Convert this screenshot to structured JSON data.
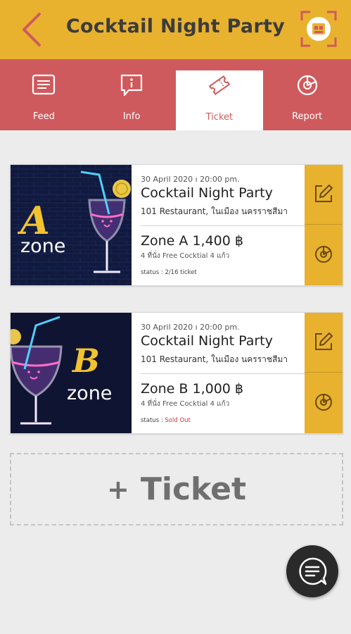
{
  "header": {
    "title": "Cocktail Night Party",
    "back_icon": "chevron-left-icon",
    "scan_icon": "qr-scan-icon"
  },
  "colors": {
    "header_bg": "#e8b22f",
    "tabs_bg": "#cf5a5d",
    "accent_red": "#cf5a5d",
    "sold_out": "#c73a3a"
  },
  "tabs": [
    {
      "label": "Feed",
      "icon": "feed-icon"
    },
    {
      "label": "Info",
      "icon": "info-icon"
    },
    {
      "label": "Ticket",
      "icon": "ticket-icon",
      "active": true
    },
    {
      "label": "Report",
      "icon": "report-icon"
    }
  ],
  "tickets": [
    {
      "art_letter": "A",
      "art_word": "zone",
      "date": "30 April 2020 ı 20:00 pm.",
      "event_name": "Cocktail Night Party",
      "venue": "101 Restaurant, ในเมือง นครราชสีมา",
      "zone": "Zone A 1,400 ฿",
      "desc": "4 ที่นั่ง Free Cocktial 4 แก้ว",
      "status_label": "status : ",
      "status_value": "2/16 ticket"
    },
    {
      "art_letter": "B",
      "art_word": "zone",
      "date": "30 April 2020 ı 20:00 pm.",
      "event_name": "Cocktail Night Party",
      "venue": "101 Restaurant, ในเมือง นครราชสีมา",
      "zone": "Zone B 1,000 ฿",
      "desc": "4 ที่นั่ง Free Cocktial 4 แก้ว",
      "status_label": "status : ",
      "status_value": "Sold Out"
    }
  ],
  "add_ticket": {
    "plus": "+",
    "label": "Ticket"
  },
  "chat_icon": "chat-menu-icon"
}
